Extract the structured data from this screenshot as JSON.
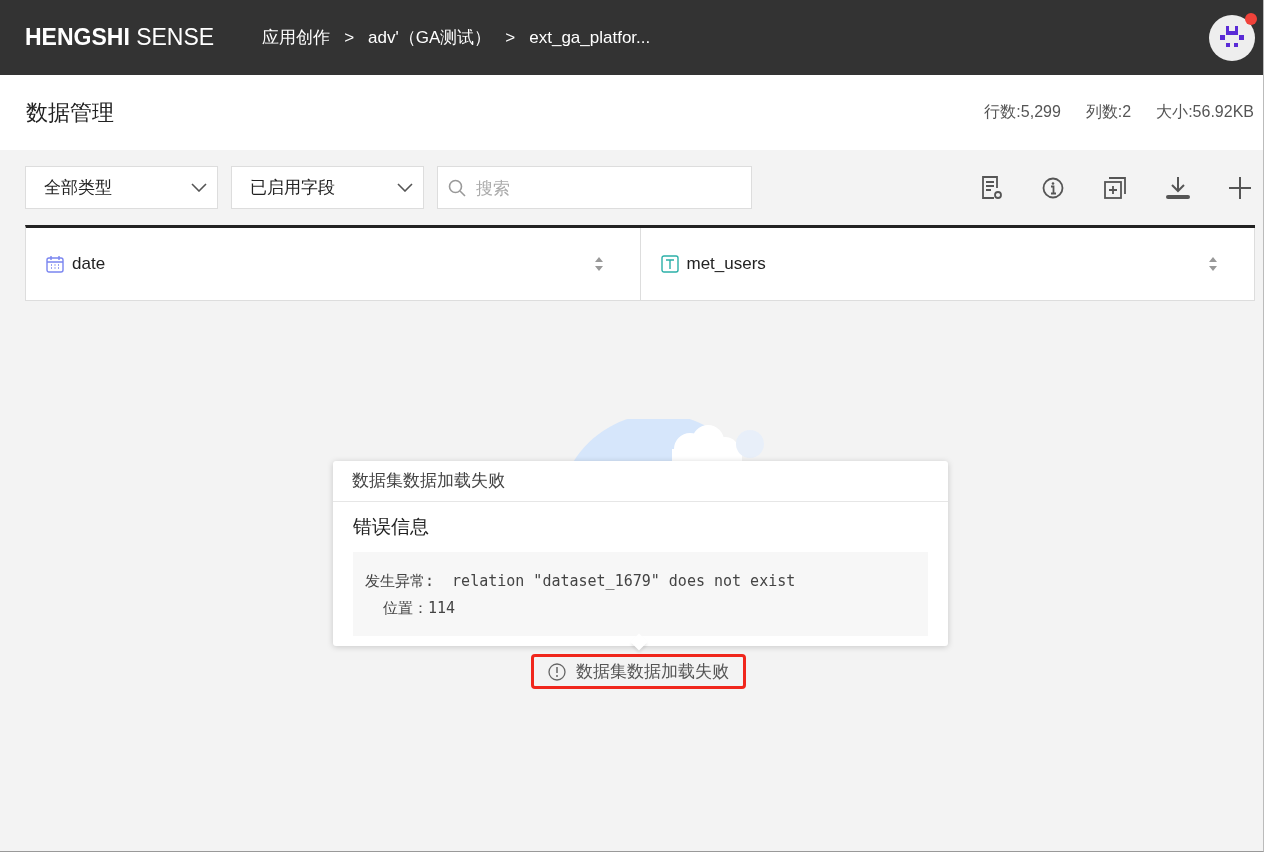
{
  "header": {
    "logo_bold": "HENGSHI",
    "logo_light": "SENSE",
    "breadcrumbs": [
      "应用创作",
      "adv'（GA测试）",
      "ext_ga_platfor..."
    ],
    "breadcrumb_separator": ">",
    "notification": true
  },
  "page": {
    "title": "数据管理",
    "stats": [
      "行数:5,299",
      "列数:2",
      "大小:56.92KB"
    ]
  },
  "toolbar": {
    "filters": [
      {
        "value": "全部类型"
      },
      {
        "value": "已启用字段"
      }
    ],
    "search": {
      "placeholder": "搜索"
    }
  },
  "table": {
    "columns": [
      {
        "name": "date",
        "kind": "date"
      },
      {
        "name": "met_users",
        "kind": "text"
      }
    ]
  },
  "error_popover": {
    "title": "数据集数据加载失败",
    "heading": "错误信息",
    "message": "发生异常:  relation \"dataset_1679\" does not exist\n  位置：114"
  },
  "error_label": {
    "text": "数据集数据加载失败",
    "highlighted": true
  }
}
